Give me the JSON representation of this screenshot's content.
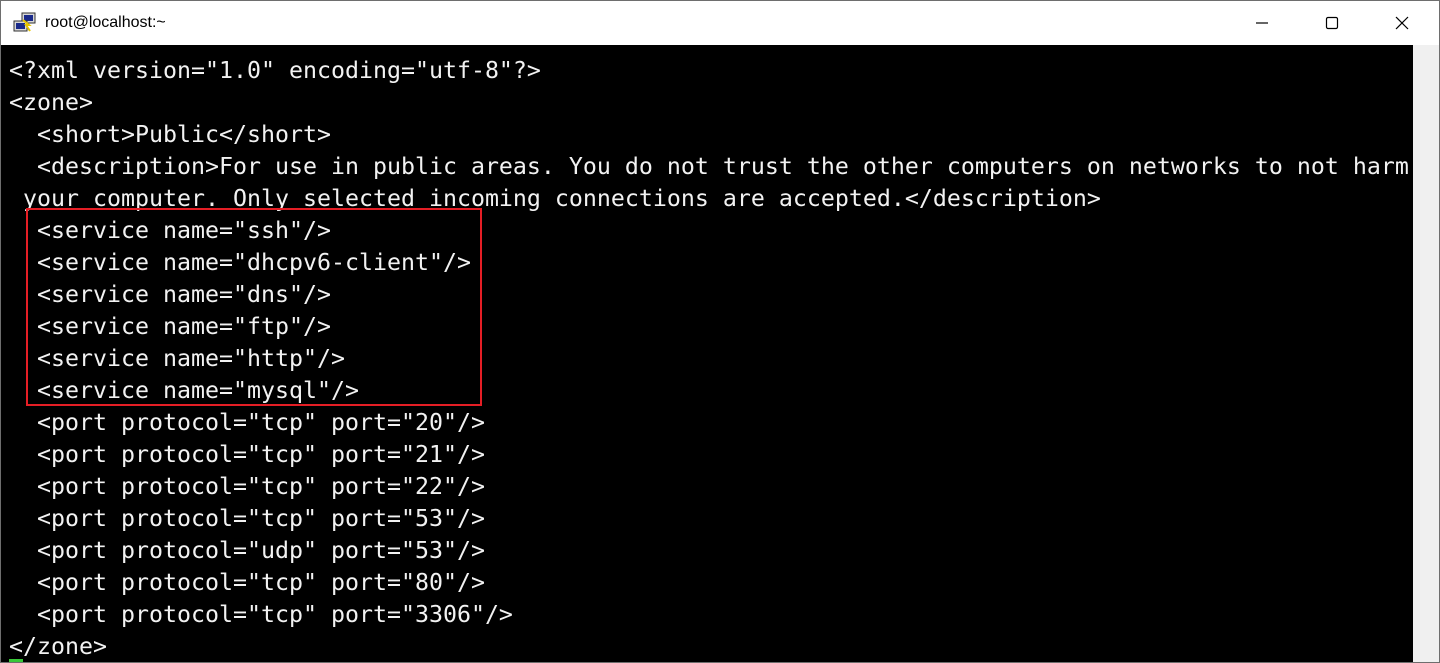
{
  "window": {
    "title": "root@localhost:~",
    "controls": {
      "minimize": "minimize",
      "maximize": "maximize",
      "close": "close"
    }
  },
  "terminal": {
    "lines": [
      "<?xml version=\"1.0\" encoding=\"utf-8\"?>",
      "<zone>",
      "  <short>Public</short>",
      "  <description>For use in public areas. You do not trust the other computers on networks to not harm",
      " your computer. Only selected incoming connections are accepted.</description>",
      "  <service name=\"ssh\"/>",
      "  <service name=\"dhcpv6-client\"/>",
      "  <service name=\"dns\"/>",
      "  <service name=\"ftp\"/>",
      "  <service name=\"http\"/>",
      "  <service name=\"mysql\"/>",
      "  <port protocol=\"tcp\" port=\"20\"/>",
      "  <port protocol=\"tcp\" port=\"21\"/>",
      "  <port protocol=\"tcp\" port=\"22\"/>",
      "  <port protocol=\"tcp\" port=\"53\"/>",
      "  <port protocol=\"udp\" port=\"53\"/>",
      "  <port protocol=\"tcp\" port=\"80\"/>",
      "  <port protocol=\"tcp\" port=\"3306\"/>",
      "</zone>"
    ],
    "colors": {
      "background": "#000000",
      "text": "#f2f2f2",
      "highlight_border": "#e51e25",
      "cursor": "#38c838"
    }
  }
}
